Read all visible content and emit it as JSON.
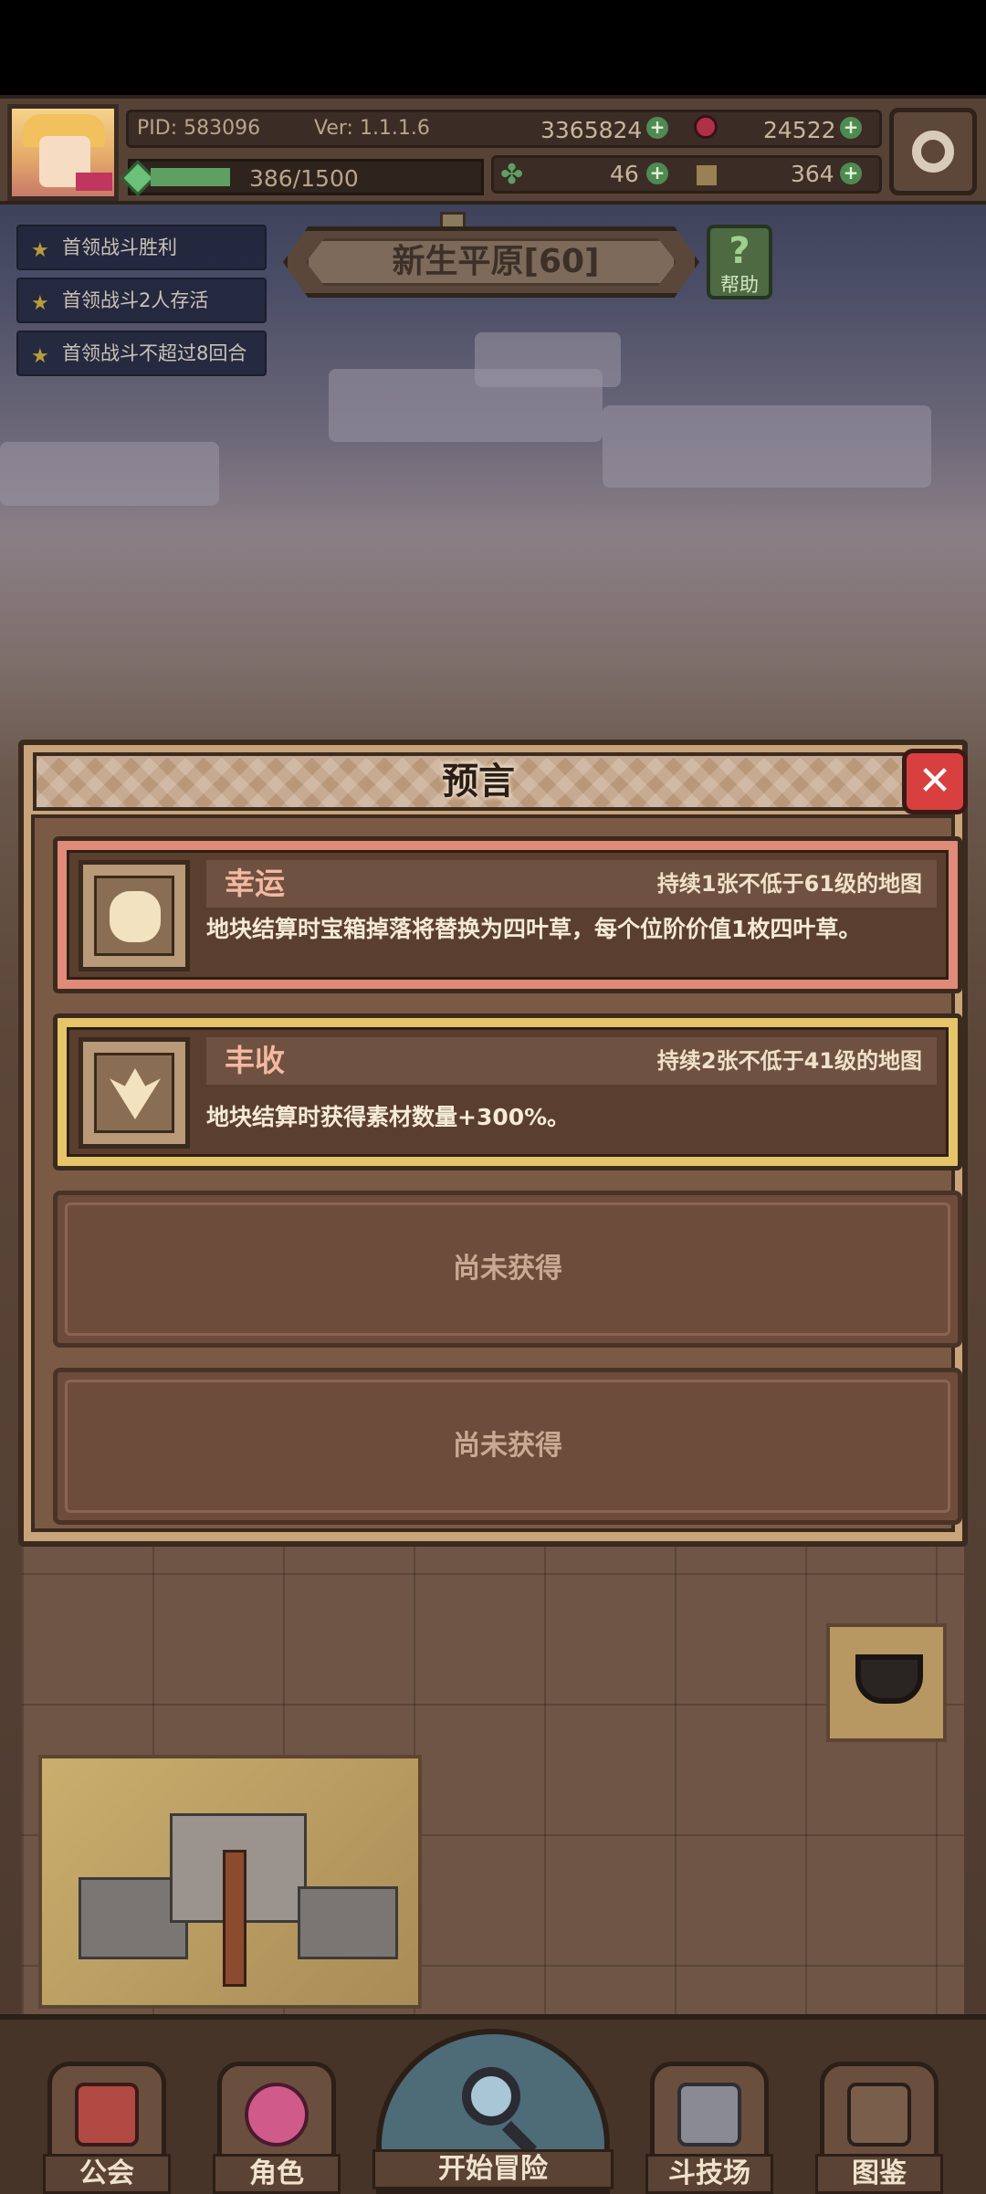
{
  "hud": {
    "pid": "PID: 583096",
    "version": "Ver: 1.1.1.6",
    "gold": "3365824",
    "gems": "24522",
    "exp_text": "386/1500",
    "exp_current": 386,
    "exp_max": 1500,
    "clover": "46",
    "materials": "364"
  },
  "quests": [
    {
      "label": "首领战斗胜利"
    },
    {
      "label": "首领战斗2人存活"
    },
    {
      "label": "首领战斗不超过8回合"
    }
  ],
  "map": {
    "title": "新生平原[60]",
    "help_label": "帮助"
  },
  "dialog": {
    "title": "预言",
    "close_icon": "close-icon",
    "cards": [
      {
        "name": "幸运",
        "duration": "持续1张不低于61级的地图",
        "description": "地块结算时宝箱掉落将替换为四叶草，每个位阶价值1枚四叶草。",
        "accent": "#e08a7a",
        "icon": "four-leaf-clover-icon"
      },
      {
        "name": "丰收",
        "duration": "持续2张不低于41级的地图",
        "description": "地块结算时获得素材数量+300%。",
        "accent": "#e6c56a",
        "icon": "harvest-leaf-icon"
      }
    ],
    "empty_slots": [
      {
        "label": "尚未获得"
      },
      {
        "label": "尚未获得"
      }
    ]
  },
  "nav": {
    "guild": "公会",
    "character": "角色",
    "start_adventure": "开始冒险",
    "arena": "斗技场",
    "codex": "图鉴"
  },
  "colors": {
    "panel": "#c9a47a",
    "panel_dark": "#7b5a45",
    "close_red": "#d7403e",
    "exp_green": "#5ea063"
  }
}
